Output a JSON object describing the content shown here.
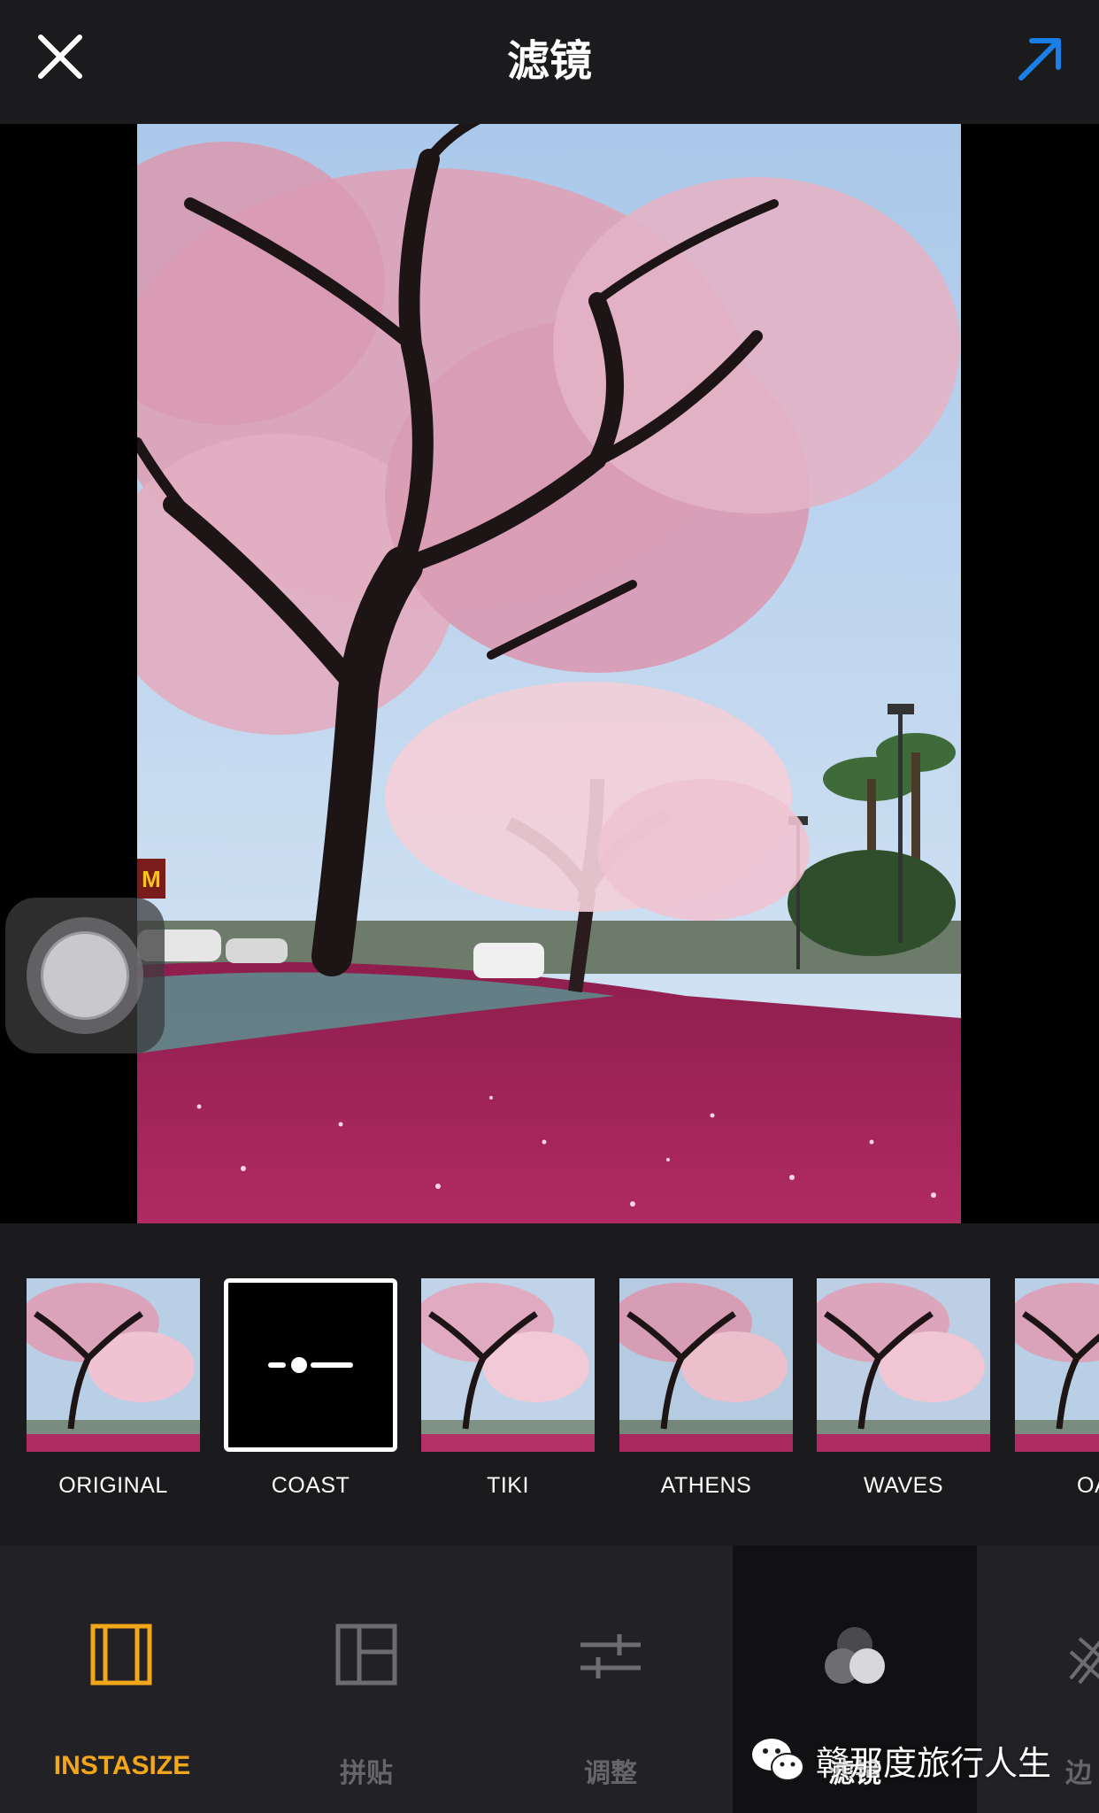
{
  "header": {
    "title": "滤镜",
    "close_icon": "close-icon",
    "share_icon": "arrow-up-right-icon",
    "share_color": "#1a7fe6"
  },
  "filters": [
    {
      "label": "ORIGINAL",
      "selected": false
    },
    {
      "label": "COAST",
      "selected": true
    },
    {
      "label": "TIKI",
      "selected": false
    },
    {
      "label": "ATHENS",
      "selected": false
    },
    {
      "label": "WAVES",
      "selected": false
    },
    {
      "label": "OA",
      "selected": false
    }
  ],
  "selected_filter_icon": "slider-adjust-icon",
  "toolbar": {
    "items": [
      {
        "label": "INSTASIZE",
        "icon": "instasize-frame-icon",
        "active": false,
        "color": "#f2a71b"
      },
      {
        "label": "拼贴",
        "icon": "collage-icon",
        "active": false
      },
      {
        "label": "调整",
        "icon": "adjust-sliders-icon",
        "active": false
      },
      {
        "label": "滤镜",
        "icon": "filter-circles-icon",
        "active": true
      },
      {
        "label": "边",
        "icon": "border-icon",
        "active": false
      }
    ]
  },
  "watermark": {
    "text": "赣那度旅行人生",
    "icon": "wechat-icon"
  }
}
